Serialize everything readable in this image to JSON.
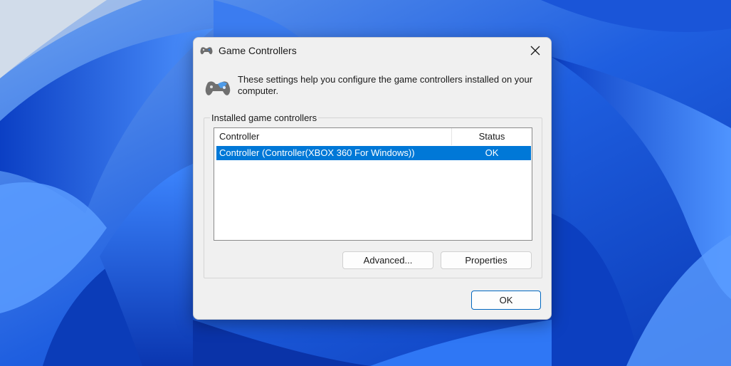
{
  "window": {
    "title": "Game Controllers"
  },
  "info": {
    "text": "These settings help you configure the game controllers installed on your computer."
  },
  "group": {
    "label": "Installed game controllers"
  },
  "list": {
    "columns": [
      "Controller",
      "Status"
    ],
    "rows": [
      {
        "controller": "Controller (Controller(XBOX 360 For Windows))",
        "status": "OK"
      }
    ]
  },
  "buttons": {
    "advanced": "Advanced...",
    "properties": "Properties",
    "ok": "OK"
  },
  "colors": {
    "accent": "#0078d7",
    "dialog_bg": "#f0f0f0",
    "wallpaper": "#2a6ee8"
  },
  "icons": {
    "title": "gamepad-icon",
    "info": "gamepad-icon",
    "close": "close-icon"
  }
}
